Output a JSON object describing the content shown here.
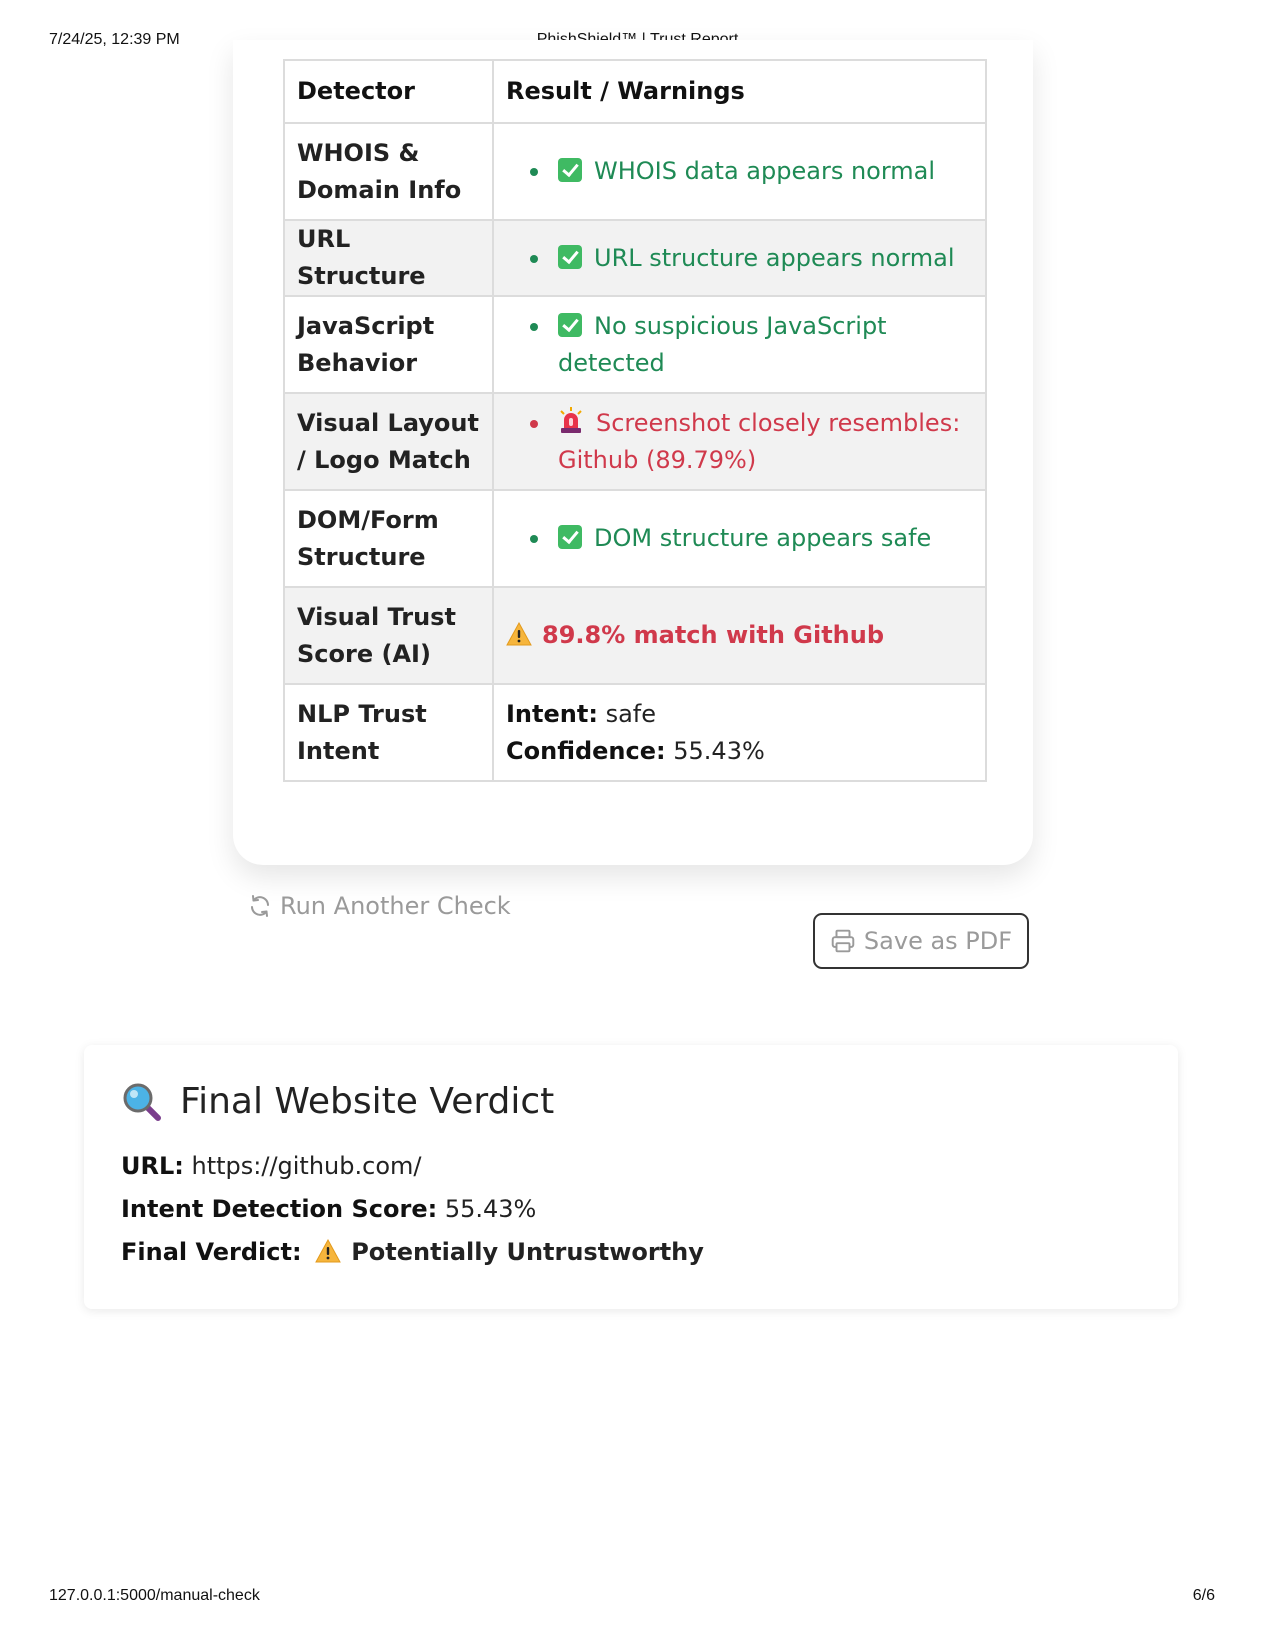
{
  "print_header": {
    "datetime": "7/24/25, 12:39 PM",
    "title": "PhishShield™ | Trust Report"
  },
  "print_footer": {
    "url": "127.0.0.1:5000/manual-check",
    "page": "6/6"
  },
  "table": {
    "headers": [
      "Detector",
      "Result / Warnings"
    ],
    "rows": [
      {
        "detector": "WHOIS & Domain Info",
        "result": "WHOIS data appears normal",
        "status": "ok",
        "icon": "check-icon"
      },
      {
        "detector": "URL Structure",
        "result": "URL structure appears normal",
        "status": "ok",
        "icon": "check-icon"
      },
      {
        "detector": "JavaScript Behavior",
        "result": "No suspicious JavaScript detected",
        "status": "ok",
        "icon": "check-icon"
      },
      {
        "detector": "Visual Layout / Logo Match",
        "result": "Screenshot closely resembles: Github (89.79%)",
        "status": "alert",
        "icon": "siren-icon"
      },
      {
        "detector": "DOM/Form Structure",
        "result": "DOM structure appears safe",
        "status": "ok",
        "icon": "check-icon"
      },
      {
        "detector": "Visual Trust Score (AI)",
        "result": "89.8% match with Github",
        "status": "warning",
        "icon": "warning-icon"
      },
      {
        "detector": "NLP Trust Intent",
        "intent_label": "Intent:",
        "intent_value": "safe",
        "confidence_label": "Confidence:",
        "confidence_value": "55.43%"
      }
    ]
  },
  "actions": {
    "run_another": "Run Another Check",
    "save_pdf": "Save as PDF"
  },
  "verdict": {
    "title": "Final Website Verdict",
    "url_label": "URL:",
    "url_value": "https://github.com/",
    "score_label": "Intent Detection Score:",
    "score_value": "55.43%",
    "verdict_label": "Final Verdict:",
    "verdict_value": "Potentially Untrustworthy"
  },
  "colors": {
    "ok": "#1f8a55",
    "alert": "#d0394b",
    "row_shade": "#f2f2f2"
  }
}
